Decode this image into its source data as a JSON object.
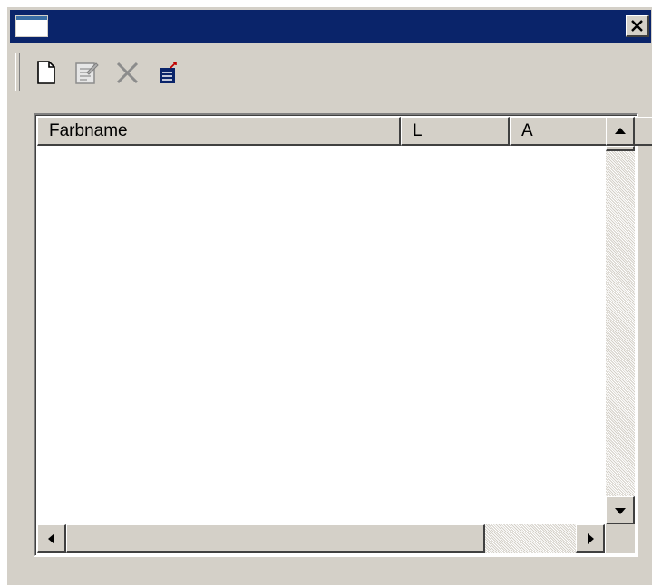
{
  "window": {
    "title": ""
  },
  "toolbar": {
    "buttons": [
      {
        "icon": "new-document-icon"
      },
      {
        "icon": "properties-icon"
      },
      {
        "icon": "delete-icon"
      },
      {
        "icon": "import-icon"
      }
    ]
  },
  "list": {
    "columns": [
      "Farbname",
      "L",
      "A"
    ],
    "rows": []
  },
  "colors": {
    "titlebar": "#0a246a",
    "face": "#d4d0c8"
  }
}
